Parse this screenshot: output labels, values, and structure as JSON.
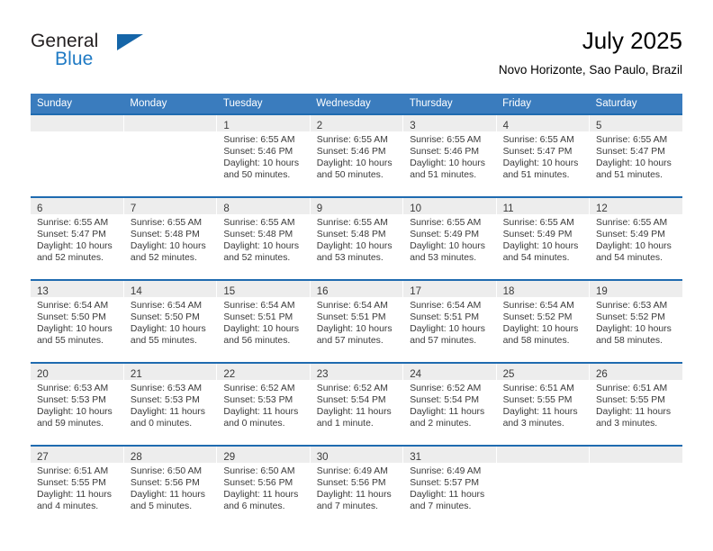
{
  "brand": {
    "name_part1": "General",
    "name_part2": "Blue",
    "triangle_color": "#1565a8",
    "blue_color": "#1f7ac4"
  },
  "header": {
    "title": "July 2025",
    "subtitle": "Novo Horizonte, Sao Paulo, Brazil"
  },
  "theme": {
    "header_bar_color": "#3a7cbe",
    "row_rule_color": "#1f6bb0",
    "daynum_band_color": "#ededed",
    "text_color": "#3a3a3a"
  },
  "weekday_headers": [
    "Sunday",
    "Monday",
    "Tuesday",
    "Wednesday",
    "Thursday",
    "Friday",
    "Saturday"
  ],
  "weeks": [
    [
      {
        "day": "",
        "lines": []
      },
      {
        "day": "",
        "lines": []
      },
      {
        "day": "1",
        "lines": [
          "Sunrise: 6:55 AM",
          "Sunset: 5:46 PM",
          "Daylight: 10 hours",
          "and 50 minutes."
        ]
      },
      {
        "day": "2",
        "lines": [
          "Sunrise: 6:55 AM",
          "Sunset: 5:46 PM",
          "Daylight: 10 hours",
          "and 50 minutes."
        ]
      },
      {
        "day": "3",
        "lines": [
          "Sunrise: 6:55 AM",
          "Sunset: 5:46 PM",
          "Daylight: 10 hours",
          "and 51 minutes."
        ]
      },
      {
        "day": "4",
        "lines": [
          "Sunrise: 6:55 AM",
          "Sunset: 5:47 PM",
          "Daylight: 10 hours",
          "and 51 minutes."
        ]
      },
      {
        "day": "5",
        "lines": [
          "Sunrise: 6:55 AM",
          "Sunset: 5:47 PM",
          "Daylight: 10 hours",
          "and 51 minutes."
        ]
      }
    ],
    [
      {
        "day": "6",
        "lines": [
          "Sunrise: 6:55 AM",
          "Sunset: 5:47 PM",
          "Daylight: 10 hours",
          "and 52 minutes."
        ]
      },
      {
        "day": "7",
        "lines": [
          "Sunrise: 6:55 AM",
          "Sunset: 5:48 PM",
          "Daylight: 10 hours",
          "and 52 minutes."
        ]
      },
      {
        "day": "8",
        "lines": [
          "Sunrise: 6:55 AM",
          "Sunset: 5:48 PM",
          "Daylight: 10 hours",
          "and 52 minutes."
        ]
      },
      {
        "day": "9",
        "lines": [
          "Sunrise: 6:55 AM",
          "Sunset: 5:48 PM",
          "Daylight: 10 hours",
          "and 53 minutes."
        ]
      },
      {
        "day": "10",
        "lines": [
          "Sunrise: 6:55 AM",
          "Sunset: 5:49 PM",
          "Daylight: 10 hours",
          "and 53 minutes."
        ]
      },
      {
        "day": "11",
        "lines": [
          "Sunrise: 6:55 AM",
          "Sunset: 5:49 PM",
          "Daylight: 10 hours",
          "and 54 minutes."
        ]
      },
      {
        "day": "12",
        "lines": [
          "Sunrise: 6:55 AM",
          "Sunset: 5:49 PM",
          "Daylight: 10 hours",
          "and 54 minutes."
        ]
      }
    ],
    [
      {
        "day": "13",
        "lines": [
          "Sunrise: 6:54 AM",
          "Sunset: 5:50 PM",
          "Daylight: 10 hours",
          "and 55 minutes."
        ]
      },
      {
        "day": "14",
        "lines": [
          "Sunrise: 6:54 AM",
          "Sunset: 5:50 PM",
          "Daylight: 10 hours",
          "and 55 minutes."
        ]
      },
      {
        "day": "15",
        "lines": [
          "Sunrise: 6:54 AM",
          "Sunset: 5:51 PM",
          "Daylight: 10 hours",
          "and 56 minutes."
        ]
      },
      {
        "day": "16",
        "lines": [
          "Sunrise: 6:54 AM",
          "Sunset: 5:51 PM",
          "Daylight: 10 hours",
          "and 57 minutes."
        ]
      },
      {
        "day": "17",
        "lines": [
          "Sunrise: 6:54 AM",
          "Sunset: 5:51 PM",
          "Daylight: 10 hours",
          "and 57 minutes."
        ]
      },
      {
        "day": "18",
        "lines": [
          "Sunrise: 6:54 AM",
          "Sunset: 5:52 PM",
          "Daylight: 10 hours",
          "and 58 minutes."
        ]
      },
      {
        "day": "19",
        "lines": [
          "Sunrise: 6:53 AM",
          "Sunset: 5:52 PM",
          "Daylight: 10 hours",
          "and 58 minutes."
        ]
      }
    ],
    [
      {
        "day": "20",
        "lines": [
          "Sunrise: 6:53 AM",
          "Sunset: 5:53 PM",
          "Daylight: 10 hours",
          "and 59 minutes."
        ]
      },
      {
        "day": "21",
        "lines": [
          "Sunrise: 6:53 AM",
          "Sunset: 5:53 PM",
          "Daylight: 11 hours",
          "and 0 minutes."
        ]
      },
      {
        "day": "22",
        "lines": [
          "Sunrise: 6:52 AM",
          "Sunset: 5:53 PM",
          "Daylight: 11 hours",
          "and 0 minutes."
        ]
      },
      {
        "day": "23",
        "lines": [
          "Sunrise: 6:52 AM",
          "Sunset: 5:54 PM",
          "Daylight: 11 hours",
          "and 1 minute."
        ]
      },
      {
        "day": "24",
        "lines": [
          "Sunrise: 6:52 AM",
          "Sunset: 5:54 PM",
          "Daylight: 11 hours",
          "and 2 minutes."
        ]
      },
      {
        "day": "25",
        "lines": [
          "Sunrise: 6:51 AM",
          "Sunset: 5:55 PM",
          "Daylight: 11 hours",
          "and 3 minutes."
        ]
      },
      {
        "day": "26",
        "lines": [
          "Sunrise: 6:51 AM",
          "Sunset: 5:55 PM",
          "Daylight: 11 hours",
          "and 3 minutes."
        ]
      }
    ],
    [
      {
        "day": "27",
        "lines": [
          "Sunrise: 6:51 AM",
          "Sunset: 5:55 PM",
          "Daylight: 11 hours",
          "and 4 minutes."
        ]
      },
      {
        "day": "28",
        "lines": [
          "Sunrise: 6:50 AM",
          "Sunset: 5:56 PM",
          "Daylight: 11 hours",
          "and 5 minutes."
        ]
      },
      {
        "day": "29",
        "lines": [
          "Sunrise: 6:50 AM",
          "Sunset: 5:56 PM",
          "Daylight: 11 hours",
          "and 6 minutes."
        ]
      },
      {
        "day": "30",
        "lines": [
          "Sunrise: 6:49 AM",
          "Sunset: 5:56 PM",
          "Daylight: 11 hours",
          "and 7 minutes."
        ]
      },
      {
        "day": "31",
        "lines": [
          "Sunrise: 6:49 AM",
          "Sunset: 5:57 PM",
          "Daylight: 11 hours",
          "and 7 minutes."
        ]
      },
      {
        "day": "",
        "lines": []
      },
      {
        "day": "",
        "lines": []
      }
    ]
  ]
}
